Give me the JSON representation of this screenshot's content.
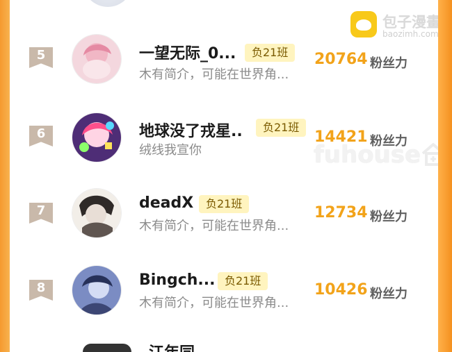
{
  "watermarks": {
    "brand_text": "包子漫畫",
    "brand_domain": "baozimh.com",
    "fuhouse_text": "fuhouse"
  },
  "ranking": [
    {
      "rank": "5",
      "name": "一望无际_0...",
      "tag": "负21班",
      "bio": "木有简介，可能在世界角...",
      "score": "20764",
      "unit": "粉丝力",
      "avatar_icon": "avatar-pink-hair"
    },
    {
      "rank": "6",
      "name": "地球没了戎星..",
      "tag": "负21班",
      "bio": "绒线我宣你",
      "score": "14421",
      "unit": "粉丝力",
      "avatar_icon": "avatar-colorful"
    },
    {
      "rank": "7",
      "name": "deadX",
      "tag": "负21班",
      "bio": "木有简介，可能在世界角...",
      "score": "12734",
      "unit": "粉丝力",
      "avatar_icon": "avatar-sketch"
    },
    {
      "rank": "8",
      "name": "Bingch...",
      "tag": "负21班",
      "bio": "木有简介，可能在世界角...",
      "score": "10426",
      "unit": "粉丝力",
      "avatar_icon": "avatar-blue"
    }
  ],
  "bottom_peek": {
    "name": "江年同"
  },
  "colors": {
    "frame_orange": "#f7a23a",
    "score_orange": "#f2a31a",
    "tag_background": "#fff4bf"
  }
}
